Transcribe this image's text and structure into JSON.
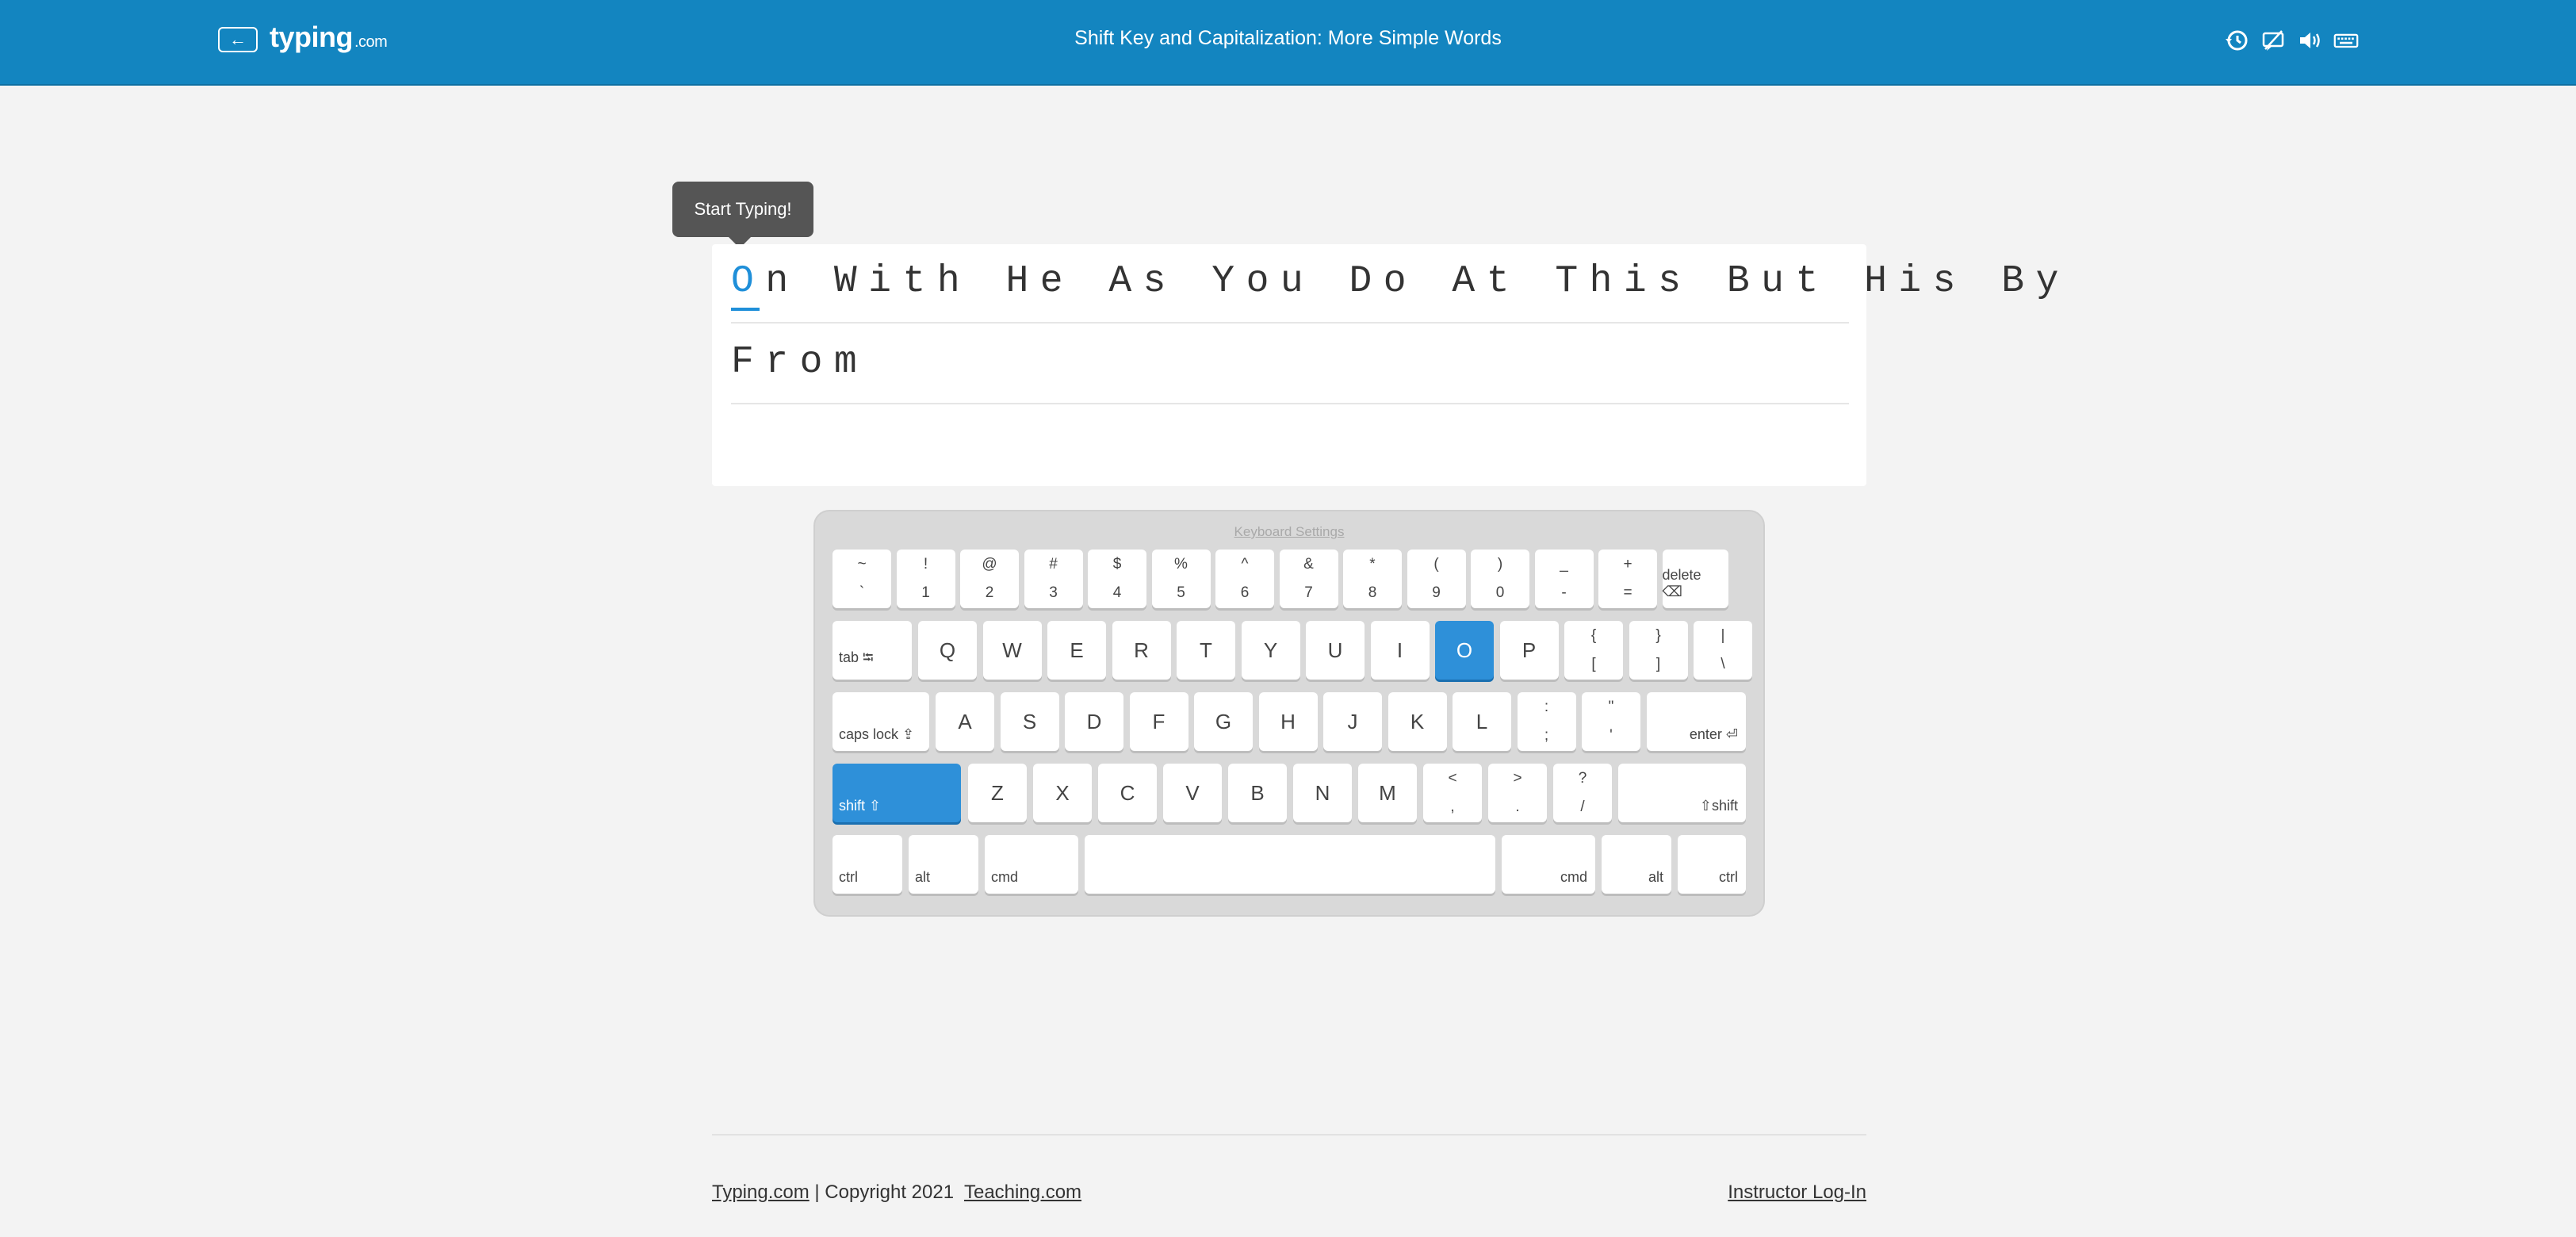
{
  "header": {
    "back_icon": "arrow-left-icon",
    "logo_main": "typing",
    "logo_suffix": ".com",
    "title": "Shift Key and Capitalization: More Simple Words",
    "icons": [
      "history-icon",
      "no-hints-icon",
      "sound-icon",
      "keyboard-icon"
    ],
    "background_color": "#1385c0"
  },
  "tooltip": {
    "text": "Start Typing!"
  },
  "typing": {
    "current_char": "O",
    "line1_rest": "n With He As You Do At This But His By",
    "line2": "From",
    "cursor_color": "#1f8fd9"
  },
  "keyboard": {
    "settings_label": "Keyboard Settings",
    "active_color": "#2e90d9",
    "rows": {
      "number": [
        {
          "top": "~",
          "bottom": "`"
        },
        {
          "top": "!",
          "bottom": "1"
        },
        {
          "top": "@",
          "bottom": "2"
        },
        {
          "top": "#",
          "bottom": "3"
        },
        {
          "top": "$",
          "bottom": "4"
        },
        {
          "top": "%",
          "bottom": "5"
        },
        {
          "top": "^",
          "bottom": "6"
        },
        {
          "top": "&",
          "bottom": "7"
        },
        {
          "top": "*",
          "bottom": "8"
        },
        {
          "top": "(",
          "bottom": "9"
        },
        {
          "top": ")",
          "bottom": "0"
        },
        {
          "top": "_",
          "bottom": "-"
        },
        {
          "top": "+",
          "bottom": "="
        }
      ],
      "delete": "delete ⌫",
      "tab": "tab ⭾",
      "qwerty": [
        "Q",
        "W",
        "E",
        "R",
        "T",
        "Y",
        "U",
        "I",
        "O",
        "P"
      ],
      "qwerty_symbols": [
        {
          "top": "{",
          "bottom": "["
        },
        {
          "top": "}",
          "bottom": "]"
        },
        {
          "top": "|",
          "bottom": "\\"
        }
      ],
      "caps": "caps lock ⇪",
      "home": [
        "A",
        "S",
        "D",
        "F",
        "G",
        "H",
        "J",
        "K",
        "L"
      ],
      "home_symbols": [
        {
          "top": ":",
          "bottom": ";"
        },
        {
          "top": "\"",
          "bottom": "'"
        }
      ],
      "enter": "enter ⏎",
      "shift_left": "shift ⇧",
      "bottom_letters": [
        "Z",
        "X",
        "C",
        "V",
        "B",
        "N",
        "M"
      ],
      "bottom_symbols": [
        {
          "top": "<",
          "bottom": ","
        },
        {
          "top": ">",
          "bottom": "."
        },
        {
          "top": "?",
          "bottom": "/"
        }
      ],
      "shift_right": "⇧shift",
      "ctrl_left": "ctrl",
      "alt_left": "alt",
      "cmd_left": "cmd",
      "cmd_right": "cmd",
      "alt_right": "alt",
      "ctrl_right": "ctrl"
    },
    "active_keys": [
      "O",
      "shift_left"
    ]
  },
  "footer": {
    "site_link": "Typing.com",
    "copyright": " | Copyright 2021  ",
    "teaching_link": "Teaching.com",
    "instructor_link": "Instructor Log-In"
  }
}
